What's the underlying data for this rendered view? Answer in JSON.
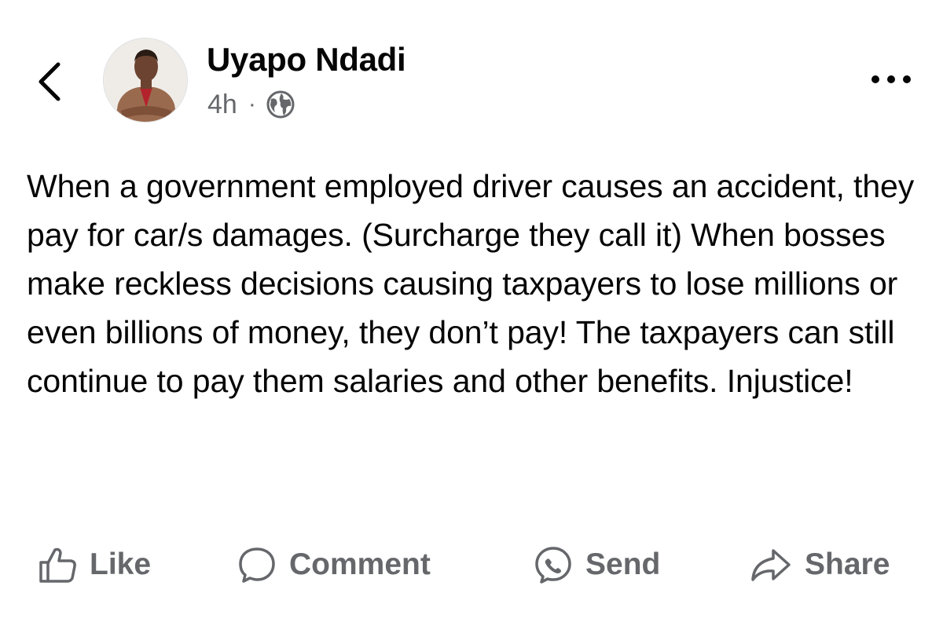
{
  "post": {
    "author": "Uyapo Ndadi",
    "time": "4h",
    "separator": "·",
    "privacy_icon": "globe-icon",
    "text": "When a government employed driver causes an accident, they pay for car/s damages. (Surcharge they call it) When bosses make reckless decisions causing taxpayers to lose millions or even billions of money, they don’t pay! The taxpayers can still continue to pay them salaries and other benefits. Injustice!"
  },
  "actions": {
    "like": "Like",
    "comment": "Comment",
    "send": "Send",
    "share": "Share"
  },
  "icons": {
    "back": "chevron-left-icon",
    "more": "more-horizontal-icon",
    "like": "thumbs-up-icon",
    "comment": "comment-bubble-icon",
    "send": "messenger-icon",
    "share": "share-arrow-icon"
  },
  "colors": {
    "text": "#050505",
    "secondary": "#65676b"
  }
}
